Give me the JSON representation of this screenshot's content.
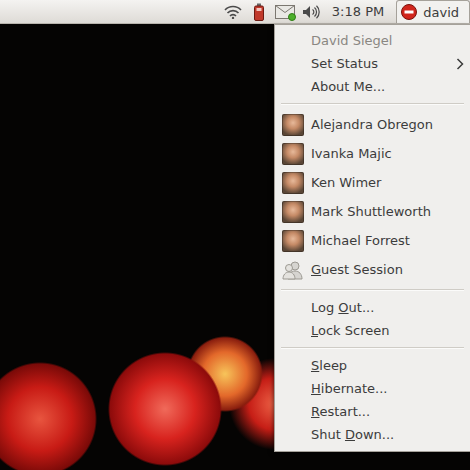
{
  "panel": {
    "messages": {
      "unread": true
    },
    "clock": "3:18 PM",
    "user": {
      "name": "david",
      "status": "busy",
      "pressed": true
    }
  },
  "menu": {
    "header": {
      "label": "David Siegel",
      "disabled": true
    },
    "sections": [
      [
        {
          "kind": "submenu",
          "label": "Set Status"
        },
        {
          "kind": "action",
          "label": "About Me..."
        }
      ],
      [
        {
          "kind": "user",
          "label": "Alejandra Obregon"
        },
        {
          "kind": "user",
          "label": "Ivanka Majic"
        },
        {
          "kind": "user",
          "label": "Ken Wimer"
        },
        {
          "kind": "user",
          "label": "Mark Shuttleworth"
        },
        {
          "kind": "user",
          "label": "Michael Forrest"
        },
        {
          "kind": "guest",
          "label": "Guest Session",
          "mnemonic": 0
        }
      ],
      [
        {
          "kind": "action",
          "label": "Log Out...",
          "mnemonic": 4
        },
        {
          "kind": "action",
          "label": "Lock Screen",
          "mnemonic": 0
        }
      ],
      [
        {
          "kind": "action",
          "label": "Sleep",
          "mnemonic": 0
        },
        {
          "kind": "action",
          "label": "Hibernate...",
          "mnemonic": 0
        },
        {
          "kind": "action",
          "label": "Restart...",
          "mnemonic": 0
        },
        {
          "kind": "action",
          "label": "Shut Down...",
          "mnemonic": 5
        }
      ]
    ]
  }
}
